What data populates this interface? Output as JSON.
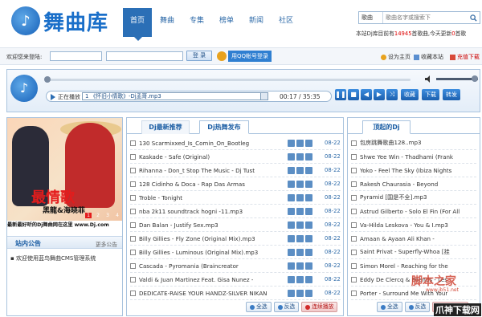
{
  "brand": {
    "logo_text": "舞曲库",
    "logo_glyph": "♪"
  },
  "nav": [
    "首页",
    "舞曲",
    "专集",
    "榜单",
    "新闻",
    "社区"
  ],
  "search": {
    "select": "歌曲",
    "placeholder": "歌曲名字或搜索下"
  },
  "stats": {
    "prefix": "本站Dj库目前有",
    "count": "14945",
    "mid": "首歌曲,今天更新",
    "today": "0",
    "suffix": "首歌"
  },
  "login": {
    "welcome": "欢迎您来登陆:",
    "submit": "登 录",
    "qq": "用QQ帐号登录"
  },
  "top_links": {
    "home": "设为主页",
    "fav": "收藏本站",
    "vip": "充值下载"
  },
  "player": {
    "playing_label": "正在播放",
    "current": "1 《怀旧小情歌》-Dj孟哥.mp3",
    "time": "00:17 / 35:35",
    "btn_fav": "收藏",
    "btn_dl": "下载",
    "btn_share": "转发",
    "progress": 0.02,
    "volume": 0.9
  },
  "banner": {
    "title": "最情歌",
    "artists": "黑龍&海晓菲",
    "footer": "最新最好听的Dj舞曲网在这里 www.Dj.com",
    "pages": [
      "1",
      "2",
      "3",
      "4"
    ]
  },
  "notice": {
    "title": "站内公告",
    "more": "更多公告",
    "items": [
      "欢迎使用蓝鸟舞曲CMS管理系统"
    ]
  },
  "center": {
    "tabs": [
      "Dj最新推荐",
      "Dj热舞发布"
    ],
    "songs": [
      "130 Scarmixxed_Is_Comin_On_Bootleg",
      "Kaskade - Safe (Original)",
      "Rihanna - Don_t Stop The Music - Dj Tust",
      "128 Cidinho & Doca - Rap Das Armas",
      "Troble - Tonight",
      "nba 2k11 soundtrack hogni -11.mp3",
      "Dan Balan - Justify Sex.mp3",
      "Billy Gillies - Fly Zone (Original Mix).mp3",
      "Billy Gillies - Luminous (Original Mix).mp3",
      "Cascada - Pyromania (Braincreator",
      "Valdi & Juan Martinez Feat. Gisa Nunez -",
      "DEDICATE-RAISE YOUR HANDZ-SILVER NIKAN"
    ],
    "date": "08-22"
  },
  "right": {
    "title": "顶起的Dj",
    "songs": [
      "包房跳舞歌曲128..mp3",
      "Shwe Yee Win - Thadhami (Frank",
      "Yoko - Feel The Sky (Ibiza Nights",
      "Rakesh Chaurasia - Beyond",
      "Pyramid [国是不全].mp3",
      "Astrud Gilberto - Solo El Fin (For All",
      "Va-Hilda Leskova - You & I.mp3",
      "Amaan & Ayaan Ali Khan -",
      "Saint Privat - Superfly-Whoa [挂",
      "Simon Morel - Reaching for the",
      "Eddy De Clercq & Friends - Les",
      "Porter - Surround Me With Your"
    ]
  },
  "buttons": {
    "all": "全选",
    "invert": "反选",
    "play": "连续播放"
  },
  "watermark": {
    "line1": "脚本之家",
    "line2": "www.jb51.net",
    "line3": "爪神下载网"
  },
  "colors": {
    "accent": "#2b6fb6",
    "red": "#d00"
  }
}
